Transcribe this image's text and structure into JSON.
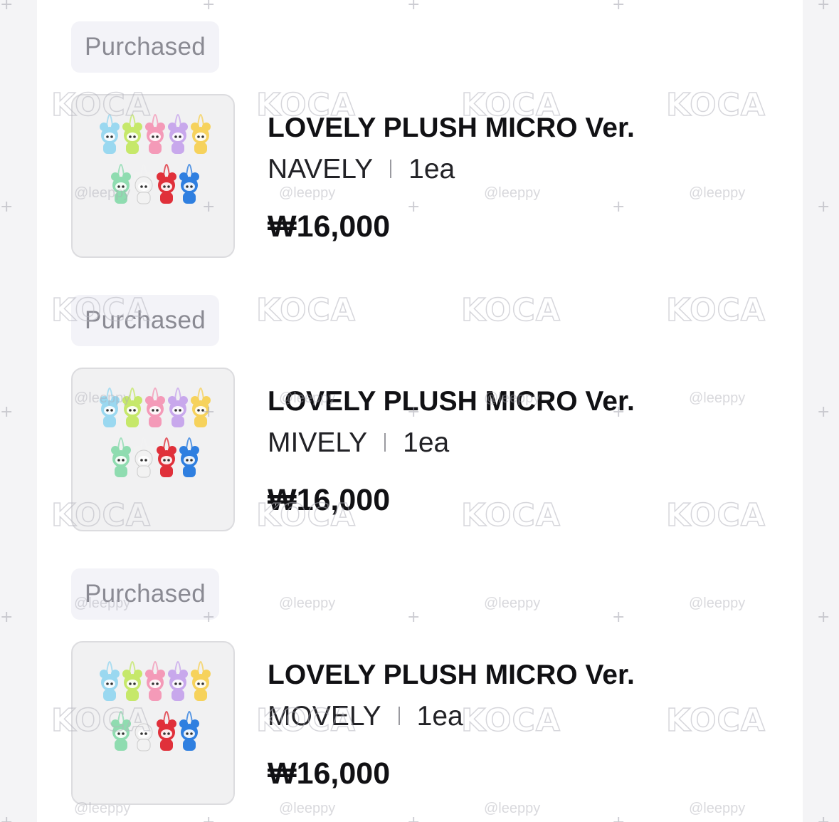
{
  "orders": [
    {
      "status": "Purchased",
      "product_name": "LOVELY PLUSH MICRO Ver.",
      "option": "NAVELY",
      "quantity": "1ea",
      "price": "₩16,000"
    },
    {
      "status": "Purchased",
      "product_name": "LOVELY PLUSH MICRO Ver.",
      "option": "MIVELY",
      "quantity": "1ea",
      "price": "₩16,000"
    },
    {
      "status": "Purchased",
      "product_name": "LOVELY PLUSH MICRO Ver.",
      "option": "MOVELY",
      "quantity": "1ea",
      "price": "₩16,000"
    }
  ],
  "watermark": {
    "logo": "KOCA",
    "handle": "@leeppy"
  },
  "plush_colors": [
    "#9ad8f0",
    "#c6e86a",
    "#f49ab8",
    "#c8a8ec",
    "#f6d25c",
    "#8fdcb0",
    "#f2f2f2",
    "#e0303a",
    "#2f7fe0"
  ]
}
